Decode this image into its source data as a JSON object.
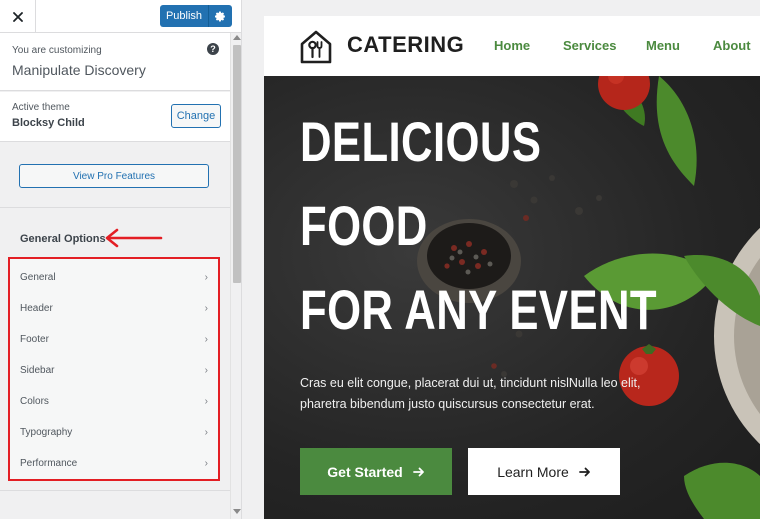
{
  "customizer": {
    "close_icon": "close-icon",
    "publish_label": "Publish",
    "publish_settings_icon": "gear-icon",
    "customizing_label": "You are customizing",
    "site_title": "Manipulate Discovery",
    "help_icon": "question-circle-icon",
    "active_theme_label": "Active theme",
    "theme_name": "Blocksy Child",
    "change_label": "Change",
    "pro_features_label": "View Pro Features",
    "section_heading": "General Options",
    "items": [
      {
        "label": "General"
      },
      {
        "label": "Header"
      },
      {
        "label": "Footer"
      },
      {
        "label": "Sidebar"
      },
      {
        "label": "Colors"
      },
      {
        "label": "Typography"
      },
      {
        "label": "Performance"
      }
    ],
    "annotation_color": "#e31e24",
    "accent_color": "#2271b1"
  },
  "preview": {
    "logo_text": "CATERING",
    "nav": [
      {
        "label": "Home"
      },
      {
        "label": "Services"
      },
      {
        "label": "Menu"
      },
      {
        "label": "About"
      }
    ],
    "hero_lines": [
      "DELICIOUS",
      "FOOD",
      "FOR ANY EVENT"
    ],
    "hero_text": "Cras eu elit congue, placerat dui ut, tincidunt nislNulla leo elit, pharetra bibendum justo quiscursus consectetur erat.",
    "cta_primary": "Get Started",
    "cta_secondary": "Learn More",
    "brand_color": "#4b8a3f"
  }
}
